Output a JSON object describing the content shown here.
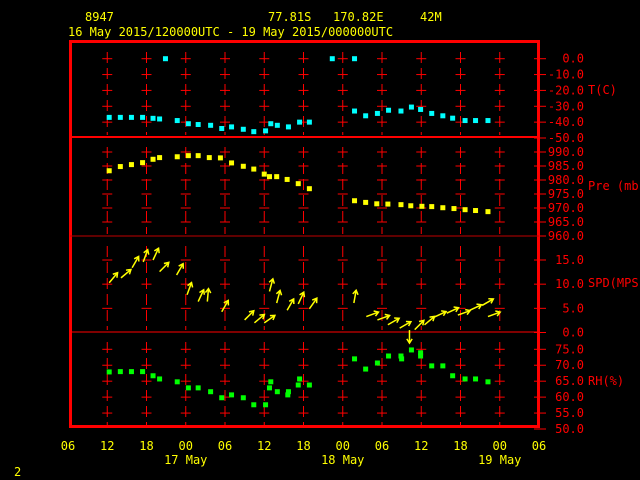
{
  "header": {
    "station": "8947",
    "lat": "77.81S",
    "lon": "170.82E",
    "elev": "42M",
    "period": "16 May 2015/120000UTC - 19 May 2015/000000UTC"
  },
  "page_number": "2",
  "colors": {
    "frame": "#ff0000",
    "text": "#ffff00",
    "temp": "#00ffff",
    "pres": "#ffff00",
    "wind": "#ffff00",
    "rh": "#00ff00"
  },
  "chart_data": {
    "type": "scatter",
    "title": "8947 77.81S 170.82E 42M",
    "subtitle": "16 May 2015/120000UTC - 19 May 2015/000000UTC",
    "x_units": "hours since 16 May 2015 12UTC",
    "xlim": [
      -6,
      66
    ],
    "x_ticks": [
      {
        "h": -6,
        "label": "06"
      },
      {
        "h": 0,
        "label": "12"
      },
      {
        "h": 6,
        "label": "18"
      },
      {
        "h": 12,
        "label": "00"
      },
      {
        "h": 18,
        "label": "06"
      },
      {
        "h": 24,
        "label": "12"
      },
      {
        "h": 30,
        "label": "18"
      },
      {
        "h": 36,
        "label": "00"
      },
      {
        "h": 42,
        "label": "06"
      },
      {
        "h": 48,
        "label": "12"
      },
      {
        "h": 54,
        "label": "18"
      },
      {
        "h": 60,
        "label": "00"
      },
      {
        "h": 66,
        "label": "06"
      }
    ],
    "date_labels": [
      {
        "h": 12,
        "label": "17 May"
      },
      {
        "h": 36,
        "label": "18 May"
      },
      {
        "h": 60,
        "label": "19 May"
      }
    ],
    "panels": [
      {
        "name": "temperature",
        "ylabel": "T(C)",
        "ylim": [
          -50,
          0
        ],
        "yticks": [
          "0.0",
          "-10.0",
          "-20.0",
          "-30.0",
          "-40.0",
          "-50.0"
        ],
        "points": [
          [
            0.3,
            -37
          ],
          [
            2,
            -37
          ],
          [
            3.7,
            -37
          ],
          [
            5.4,
            -37
          ],
          [
            7,
            -37.6
          ],
          [
            8,
            -38
          ],
          [
            8.9,
            0
          ],
          [
            10.7,
            -39
          ],
          [
            12.4,
            -41
          ],
          [
            13.9,
            -41.5
          ],
          [
            15.8,
            -42
          ],
          [
            17.5,
            -44
          ],
          [
            19,
            -43
          ],
          [
            20.8,
            -44.5
          ],
          [
            22.4,
            -46
          ],
          [
            24.2,
            -45.5
          ],
          [
            25,
            -41
          ],
          [
            26,
            -42
          ],
          [
            27.7,
            -43
          ],
          [
            29.4,
            -40
          ],
          [
            30.9,
            -40
          ],
          [
            34.4,
            0
          ],
          [
            37.8,
            0
          ],
          [
            37.8,
            -33
          ],
          [
            39.5,
            -36
          ],
          [
            41.3,
            -34.5
          ],
          [
            43,
            -32.5
          ],
          [
            44.9,
            -33
          ],
          [
            46.5,
            -30.5
          ],
          [
            47.9,
            -32
          ],
          [
            49.6,
            -34.5
          ],
          [
            51.3,
            -36
          ],
          [
            52.8,
            -37.5
          ],
          [
            54.7,
            -39
          ],
          [
            56.3,
            -39
          ],
          [
            58.2,
            -39
          ]
        ]
      },
      {
        "name": "pressure",
        "ylabel": "Pre (mb)",
        "ylim": [
          960,
          990
        ],
        "yticks": [
          "990.0",
          "985.0",
          "980.0",
          "975.0",
          "970.0",
          "965.0",
          "960.0"
        ],
        "points": [
          [
            0.3,
            983.3
          ],
          [
            2,
            984.8
          ],
          [
            3.7,
            985.5
          ],
          [
            5.4,
            986.2
          ],
          [
            7,
            987.4
          ],
          [
            8,
            988
          ],
          [
            10.7,
            988.3
          ],
          [
            12.4,
            988.7
          ],
          [
            13.9,
            988.7
          ],
          [
            15.6,
            988
          ],
          [
            17.3,
            987.9
          ],
          [
            19,
            986.1
          ],
          [
            20.8,
            984.9
          ],
          [
            22.4,
            983.9
          ],
          [
            24,
            982.1
          ],
          [
            24.8,
            981.2
          ],
          [
            25.9,
            981.2
          ],
          [
            27.5,
            980.2
          ],
          [
            29.2,
            978.7
          ],
          [
            30.9,
            976.9
          ],
          [
            37.8,
            972.6
          ],
          [
            39.5,
            972
          ],
          [
            41.2,
            971.5
          ],
          [
            42.9,
            971.4
          ],
          [
            44.9,
            971.2
          ],
          [
            46.4,
            970.8
          ],
          [
            48.1,
            970.6
          ],
          [
            49.6,
            970.5
          ],
          [
            51.3,
            970.1
          ],
          [
            53,
            969.8
          ],
          [
            54.7,
            969.4
          ],
          [
            56.3,
            969.1
          ],
          [
            58.2,
            968.7
          ]
        ]
      },
      {
        "name": "wind",
        "ylabel": "SPD(MPS)",
        "ylim": [
          0,
          15
        ],
        "yticks": [
          "15.0",
          "10.0",
          "5.0",
          "0.0"
        ],
        "points": [
          [
            0.3,
            10.3,
            40
          ],
          [
            2.1,
            11.3,
            50
          ],
          [
            3.8,
            13.4,
            30
          ],
          [
            5.5,
            14.6,
            20
          ],
          [
            7,
            15,
            25
          ],
          [
            8,
            12.6,
            45
          ],
          [
            10.6,
            11.9,
            30
          ],
          [
            12.2,
            7.8,
            20
          ],
          [
            13.9,
            6.4,
            25
          ],
          [
            15.3,
            6.4,
            5
          ],
          [
            17.5,
            4.3,
            30
          ],
          [
            20.999,
            2.6,
            45
          ],
          [
            22.5,
            2,
            50
          ],
          [
            24,
            2,
            55
          ],
          [
            24.8,
            8.5,
            15
          ],
          [
            25.9,
            6.1,
            15
          ],
          [
            27.5,
            4.6,
            30
          ],
          [
            29.2,
            5.9,
            25
          ],
          [
            30.9,
            4.9,
            35
          ],
          [
            37.7,
            6.1,
            10
          ],
          [
            39.6,
            3.3,
            70
          ],
          [
            41.3,
            2.6,
            70
          ],
          [
            42.9,
            1.6,
            60
          ],
          [
            44.7,
            0.9,
            60
          ],
          [
            46.2,
            0.5,
            180
          ],
          [
            47,
            0.6,
            45
          ],
          [
            48.5,
            1.6,
            50
          ],
          [
            50,
            3.2,
            65
          ],
          [
            51.9,
            4,
            65
          ],
          [
            53.6,
            3.6,
            70
          ],
          [
            55.4,
            4.6,
            65
          ],
          [
            57.3,
            5.6,
            60
          ],
          [
            58.2,
            3.3,
            70
          ]
        ]
      },
      {
        "name": "relative-humidity",
        "ylabel": "RH(%)",
        "ylim": [
          50,
          75
        ],
        "yticks": [
          "75.0",
          "70.0",
          "65.0",
          "60.0",
          "55.0",
          "50.0"
        ],
        "points": [
          [
            0.3,
            67.9
          ],
          [
            2,
            68
          ],
          [
            3.7,
            68
          ],
          [
            5.4,
            68
          ],
          [
            7,
            66.7
          ],
          [
            8,
            65.7
          ],
          [
            10.7,
            64.8
          ],
          [
            12.4,
            62.9
          ],
          [
            13.9,
            62.9
          ],
          [
            15.8,
            61.7
          ],
          [
            17.5,
            59.8
          ],
          [
            19,
            60.7
          ],
          [
            20.8,
            59.8
          ],
          [
            22.4,
            57.6
          ],
          [
            24.2,
            57.6
          ],
          [
            25,
            64.8
          ],
          [
            24.8,
            62.9
          ],
          [
            26,
            61.7
          ],
          [
            27.7,
            61.7
          ],
          [
            27.6,
            60.7
          ],
          [
            29.4,
            65.7
          ],
          [
            29.2,
            63.8
          ],
          [
            30.9,
            63.8
          ],
          [
            37.8,
            72
          ],
          [
            39.5,
            68.8
          ],
          [
            41.3,
            70.7
          ],
          [
            43,
            72.9
          ],
          [
            44.9,
            72.9
          ],
          [
            45,
            72
          ],
          [
            46.5,
            74.8
          ],
          [
            47.9,
            73.9
          ],
          [
            47.9,
            72.9
          ],
          [
            49.6,
            69.8
          ],
          [
            51.3,
            69.8
          ],
          [
            52.8,
            66.7
          ],
          [
            54.7,
            65.7
          ],
          [
            56.3,
            65.7
          ],
          [
            58.2,
            64.8
          ]
        ]
      }
    ]
  }
}
